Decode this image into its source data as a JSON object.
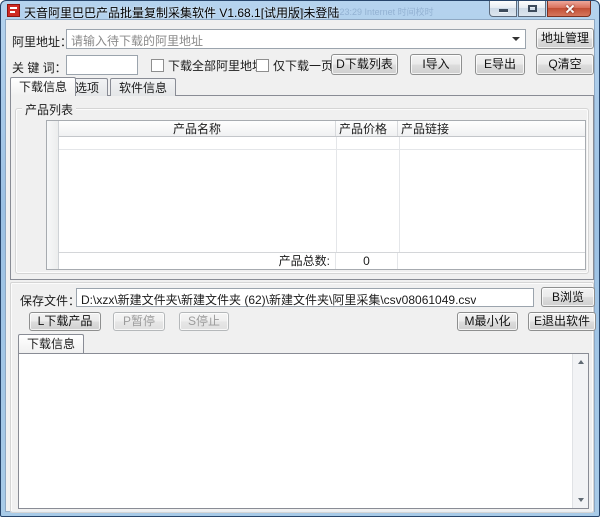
{
  "window": {
    "title": "天音阿里巴巴产品批量复制采集软件 V1.68.1[试用版]未登陆",
    "watermark": "2016-08-16 23:29      Internet 时间校时"
  },
  "address_row": {
    "label": "阿里地址：",
    "placeholder": "请输入待下载的阿里地址",
    "manage_button": "地址管理"
  },
  "keyword_row": {
    "label": "关 键 词：",
    "keyword_value": "",
    "checkbox_all_label": "下载全部阿里地址",
    "checkbox_one_page_label": "仅下载一页",
    "download_list_button": "D下载列表",
    "import_button": "I导入",
    "export_button": "E导出",
    "clear_button": "Q清空"
  },
  "tabs": [
    {
      "label": "下载信息"
    },
    {
      "label": "选项"
    },
    {
      "label": "软件信息"
    }
  ],
  "product_panel": {
    "group_title": "产品列表",
    "table": {
      "columns": [
        "产品名称",
        "产品价格",
        "产品链接"
      ],
      "rows": [],
      "total_label": "产品总数:",
      "total_value": "0"
    }
  },
  "save_row": {
    "label": "保存文件：",
    "path": "D:\\xzx\\新建文件夹\\新建文件夹 (62)\\新建文件夹\\阿里采集\\csv08061049.csv",
    "browse_button": "B浏览"
  },
  "action_row": {
    "download_button": "L下载产品",
    "pause_button": "P暂停",
    "stop_button": "S停止",
    "minimize_button": "M最小化",
    "exit_button": "E退出软件"
  },
  "log_panel": {
    "tab_label": "下载信息",
    "content": ""
  },
  "colors": {
    "titlebar": "#a8cbe8",
    "content_bg": "#f0f0f0",
    "close_button": "#c14d33",
    "app_icon": "#cf2a24"
  }
}
